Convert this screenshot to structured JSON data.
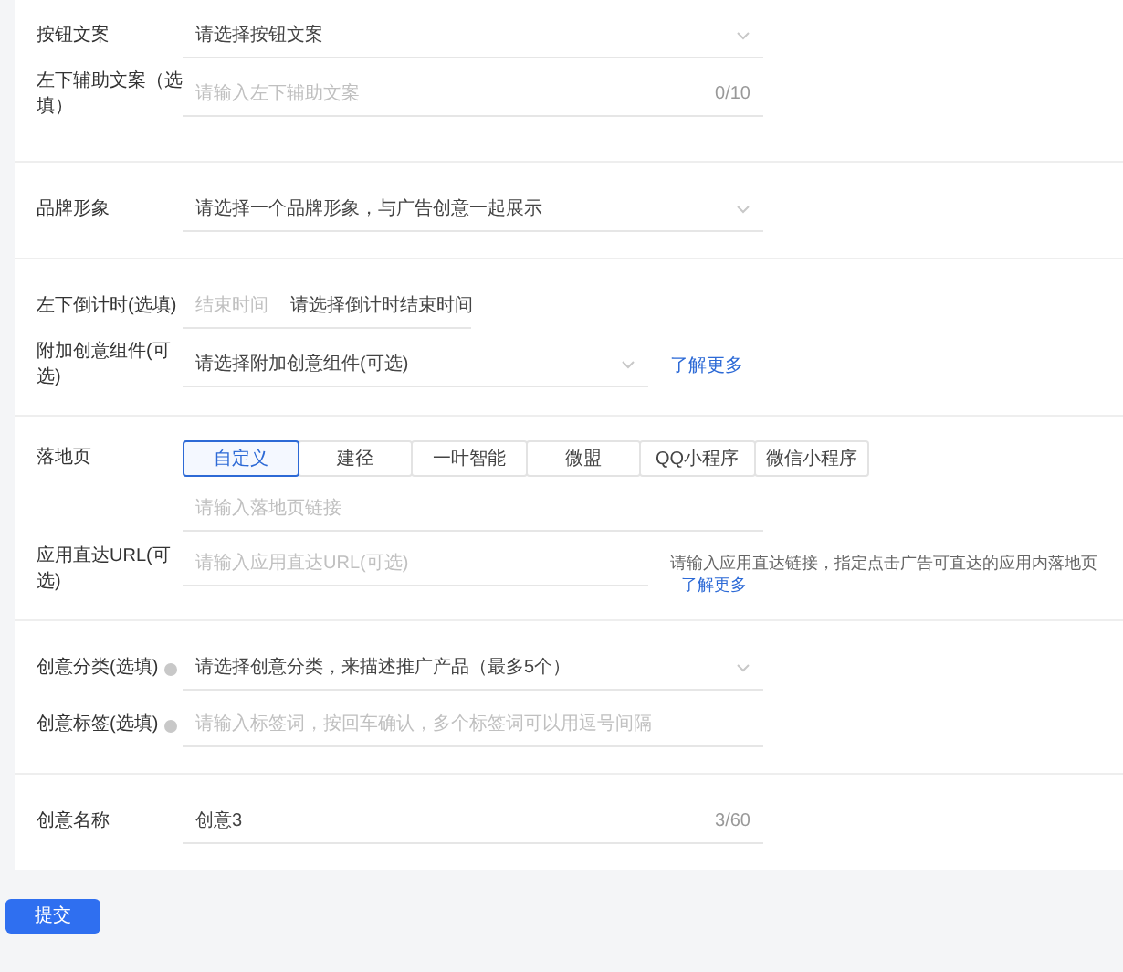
{
  "sections": [
    {
      "fields": [
        {
          "kind": "select",
          "label": "按钮文案",
          "value": "请选择按钮文案"
        },
        {
          "kind": "input",
          "label": "左下辅助文案（选填）",
          "placeholder": "请输入左下辅助文案",
          "counter": "0/10"
        }
      ]
    },
    {
      "fields": [
        {
          "kind": "select",
          "label": "品牌形象",
          "value": "请选择一个品牌形象，与广告创意一起展示"
        }
      ]
    },
    {
      "fields": [
        {
          "kind": "daterange",
          "label": "左下倒计时(选填)",
          "start_placeholder": "结束时间",
          "end_placeholder": "请选择倒计时结束时间"
        },
        {
          "kind": "select",
          "label": "附加创意组件(可选)",
          "value": "请选择附加创意组件(可选)",
          "link": "了解更多"
        }
      ]
    },
    {
      "fields": [
        {
          "kind": "tabs",
          "label": "落地页",
          "tabs": [
            {
              "label": "自定义",
              "selected": true
            },
            {
              "label": "建径",
              "selected": false
            },
            {
              "label": "一叶智能",
              "selected": false
            },
            {
              "label": "微盟",
              "selected": false
            },
            {
              "label": "QQ小程序",
              "selected": false
            },
            {
              "label": "微信小程序",
              "selected": false
            }
          ]
        },
        {
          "kind": "input",
          "placeholder": "请输入落地页链接"
        },
        {
          "kind": "input",
          "label": "应用直达URL(可选)",
          "placeholder": "请输入应用直达URL(可选)",
          "hint": "请输入应用直达链接，指定点击广告可直达的应用内落地页",
          "link": "了解更多"
        }
      ]
    },
    {
      "fields": [
        {
          "kind": "select",
          "label": "创意分类(选填)",
          "info": true,
          "value": "请选择创意分类，来描述推广产品（最多5个）"
        },
        {
          "kind": "input",
          "label": "创意标签(选填)",
          "info": true,
          "placeholder": "请输入标签词，按回车确认，多个标签词可以用逗号间隔"
        }
      ]
    },
    {
      "fields": [
        {
          "kind": "input",
          "label": "创意名称",
          "value": "创意3",
          "counter": "3/60"
        }
      ]
    }
  ],
  "submit": "提交"
}
